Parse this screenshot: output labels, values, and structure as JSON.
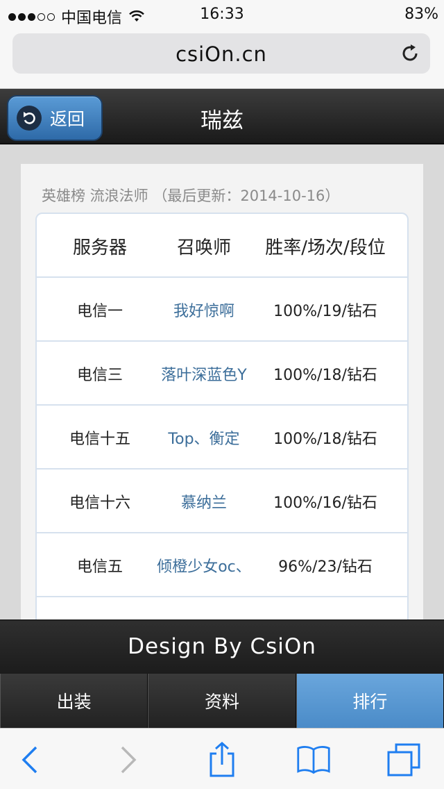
{
  "status_bar": {
    "carrier": "中国电信",
    "time": "16:33",
    "battery": "83%"
  },
  "browser": {
    "url": "csiOn.cn"
  },
  "header": {
    "back_label": "返回",
    "title": "瑞兹"
  },
  "ranking": {
    "subtitle": "英雄榜 流浪法师 （最后更新：2014-10-16）",
    "columns": [
      "服务器",
      "召唤师",
      "胜率/场次/段位"
    ],
    "rows": [
      {
        "server": "电信一",
        "summoner": "我好惊啊",
        "stats": "100%/19/钻石"
      },
      {
        "server": "电信三",
        "summoner": "落叶深蓝色Y",
        "stats": "100%/18/钻石"
      },
      {
        "server": "电信十五",
        "summoner": "Top、衡定",
        "stats": "100%/18/钻石"
      },
      {
        "server": "电信十六",
        "summoner": "慕纳兰",
        "stats": "100%/16/钻石"
      },
      {
        "server": "电信五",
        "summoner": "倾橙少女oc、",
        "stats": "96%/23/钻石"
      }
    ]
  },
  "footer": {
    "design_text": "Design By CsiOn"
  },
  "tabs": [
    {
      "label": "出装",
      "active": false
    },
    {
      "label": "资料",
      "active": false
    },
    {
      "label": "排行",
      "active": true
    }
  ],
  "toolbar": {
    "icons": [
      "back-arrow-icon",
      "forward-arrow-icon",
      "share-icon",
      "bookmarks-icon",
      "tabs-icon"
    ]
  },
  "colors": {
    "accent_blue": "#4a8bc8",
    "link_blue": "#3c6e9a",
    "ios_blue": "#1f7ef0"
  }
}
